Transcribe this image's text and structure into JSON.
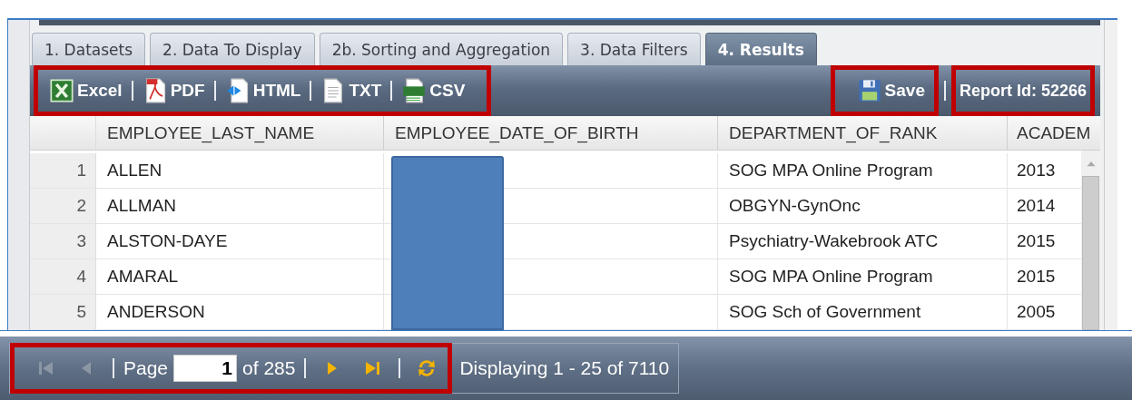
{
  "tabs": [
    {
      "label": "1. Datasets",
      "selected": false
    },
    {
      "label": "2. Data To Display",
      "selected": false
    },
    {
      "label": "2b. Sorting and Aggregation",
      "selected": false
    },
    {
      "label": "3. Data Filters",
      "selected": false
    },
    {
      "label": "4. Results",
      "selected": true
    }
  ],
  "toolbar": {
    "exports_highlighted": true,
    "exports": [
      {
        "kind": "excel",
        "label": "Excel"
      },
      {
        "kind": "pdf",
        "label": "PDF"
      },
      {
        "kind": "html",
        "label": "HTML"
      },
      {
        "kind": "txt",
        "label": "TXT"
      },
      {
        "kind": "csv",
        "label": "CSV"
      }
    ],
    "save": {
      "label": "Save",
      "highlighted": true
    },
    "report_id": {
      "text": "Report Id: 52266",
      "highlighted": true
    }
  },
  "table": {
    "columns": [
      {
        "label": "EMPLOYEE_LAST_NAME"
      },
      {
        "label": "EMPLOYEE_DATE_OF_BIRTH",
        "redacted": true
      },
      {
        "label": "DEPARTMENT_OF_RANK"
      },
      {
        "label": "ACADEM"
      }
    ],
    "rows": [
      {
        "number": "1",
        "cells": [
          "ALLEN",
          null,
          "SOG MPA Online Program",
          "2013"
        ]
      },
      {
        "number": "2",
        "cells": [
          "ALLMAN",
          null,
          "OBGYN-GynOnc",
          "2014"
        ]
      },
      {
        "number": "3",
        "cells": [
          "ALSTON-DAYE",
          null,
          "Psychiatry-Wakebrook ATC",
          "2015"
        ]
      },
      {
        "number": "4",
        "cells": [
          "AMARAL",
          null,
          "SOG MPA Online Program",
          "2015"
        ]
      },
      {
        "number": "5",
        "cells": [
          "ANDERSON",
          null,
          "SOG Sch of Government",
          "2005"
        ]
      }
    ]
  },
  "pager": {
    "highlighted": true,
    "buttons_before": [
      {
        "kind": "first",
        "disabled": true
      },
      {
        "kind": "prev",
        "disabled": true
      }
    ],
    "page_label": "Page",
    "page": "1",
    "page_count": "of 285",
    "buttons_after": [
      {
        "kind": "next",
        "disabled": false
      },
      {
        "kind": "last",
        "disabled": false
      },
      {
        "kind": "refresh",
        "disabled": false
      }
    ],
    "status": "Displaying 1 - 25 of 7110"
  }
}
